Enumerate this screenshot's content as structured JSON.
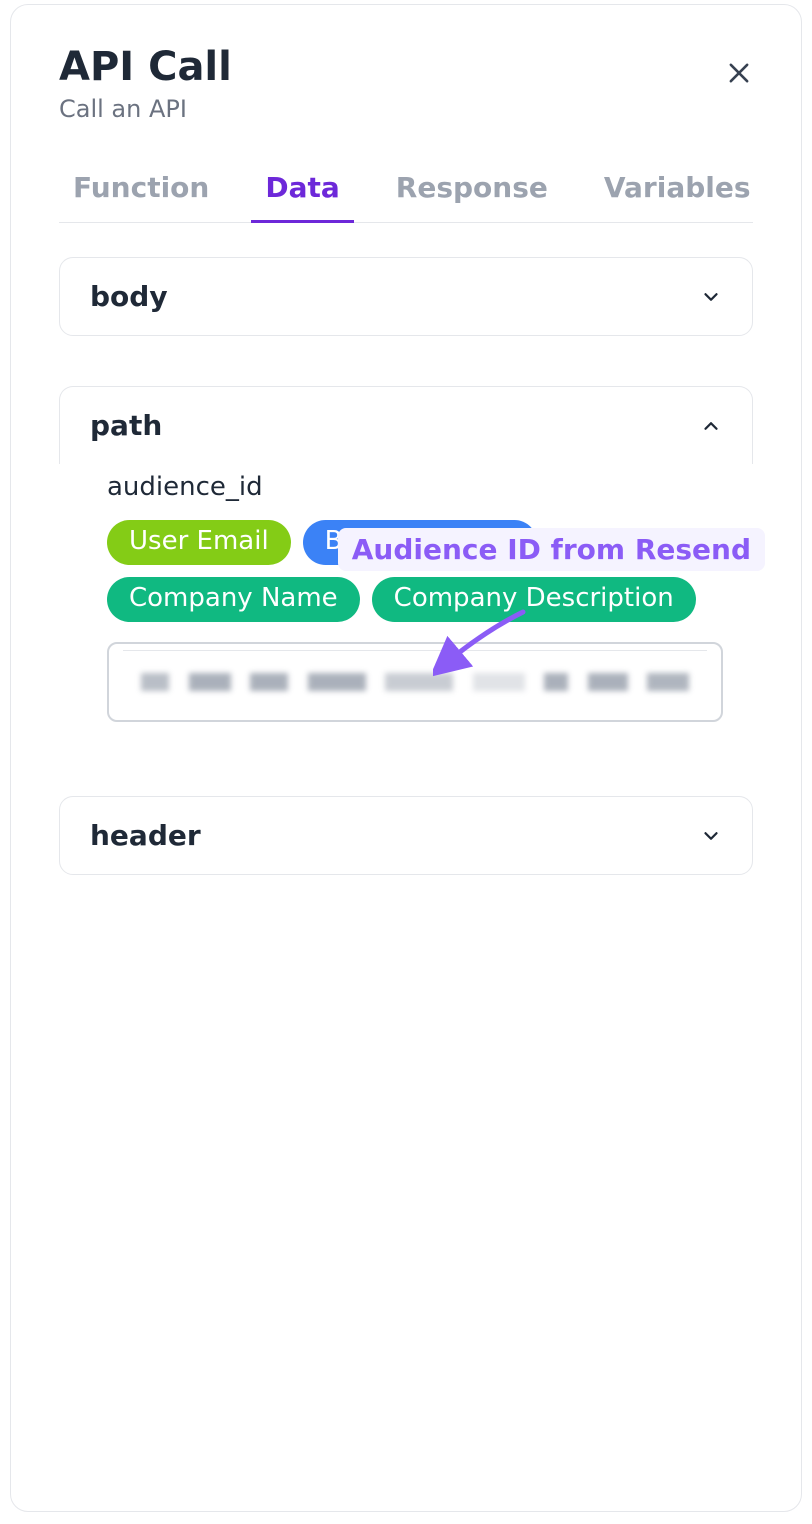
{
  "header": {
    "title": "API Call",
    "subtitle": "Call an API"
  },
  "tabs": [
    {
      "label": "Function",
      "active": false
    },
    {
      "label": "Data",
      "active": true
    },
    {
      "label": "Response",
      "active": false
    },
    {
      "label": "Variables",
      "active": false
    }
  ],
  "sections": {
    "body": {
      "title": "body",
      "expanded": false
    },
    "path": {
      "title": "path",
      "expanded": true,
      "field_label": "audience_id",
      "chips": [
        {
          "label": "User Email",
          "color": "lime"
        },
        {
          "label": "Branch Output",
          "color": "blue"
        },
        {
          "label": "Company Name",
          "color": "green"
        },
        {
          "label": "Company Description",
          "color": "green"
        }
      ]
    },
    "header_section": {
      "title": "header",
      "expanded": false
    }
  },
  "annotation": {
    "text": "Audience ID from Resend"
  }
}
